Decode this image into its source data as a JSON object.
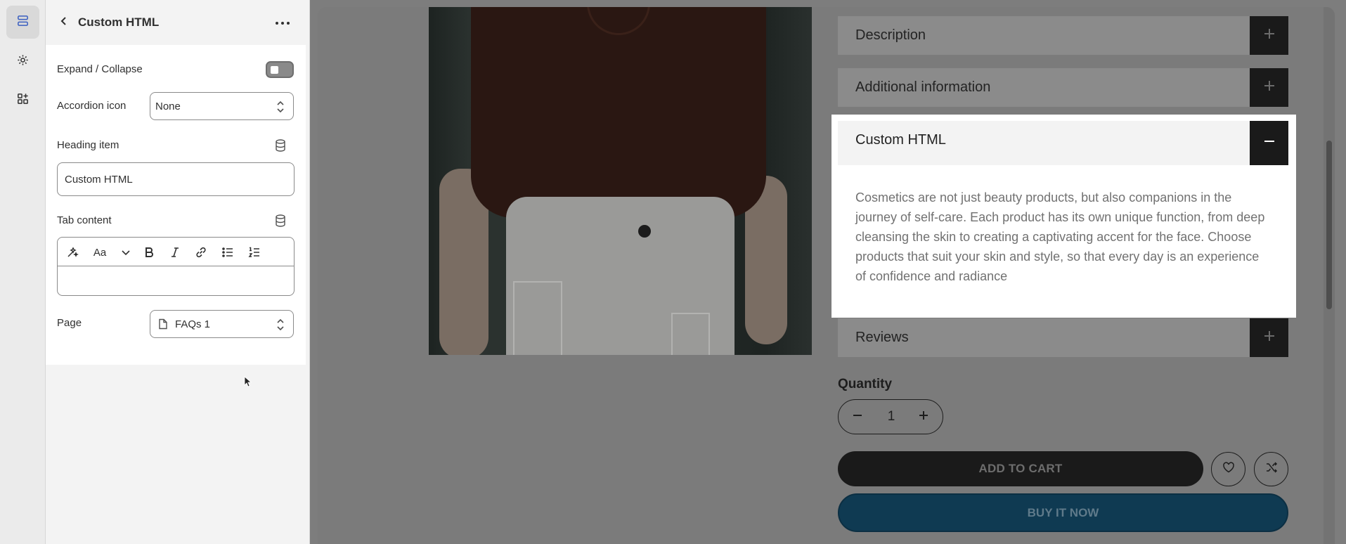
{
  "rail": {
    "items": [
      {
        "icon": "sections-icon",
        "active": true
      },
      {
        "icon": "gear-icon",
        "active": false
      },
      {
        "icon": "apps-icon",
        "active": false
      }
    ]
  },
  "panel": {
    "title": "Custom HTML",
    "fields": {
      "expand_label": "Expand / Collapse",
      "accordion_icon_label": "Accordion icon",
      "accordion_icon_value": "None",
      "heading_item_label": "Heading item",
      "heading_item_value": "Custom HTML",
      "tab_content_label": "Tab content",
      "editor_font_label": "Aa",
      "page_label": "Page",
      "page_value": "FAQs 1"
    }
  },
  "preview": {
    "accordions": [
      {
        "title": "Description",
        "state": "collapsed"
      },
      {
        "title": "Additional information",
        "state": "collapsed"
      },
      {
        "title": "Custom HTML",
        "state": "expanded"
      },
      {
        "title": "Reviews",
        "state": "collapsed"
      }
    ],
    "custom_html_body": "Cosmetics are not just beauty products, but also companions in the journey of self-care. Each product has its own unique function, from deep cleansing the skin to creating a captivating accent for the face. Choose products that suit your skin and style, so that every day is an experience of confidence and radiance",
    "quantity_label": "Quantity",
    "quantity_value": "1",
    "add_to_cart": "ADD TO CART",
    "buy_now": "BUY IT NOW"
  },
  "colors": {
    "buy_now": "#0f3a52",
    "dark": "#1a1a1a"
  }
}
